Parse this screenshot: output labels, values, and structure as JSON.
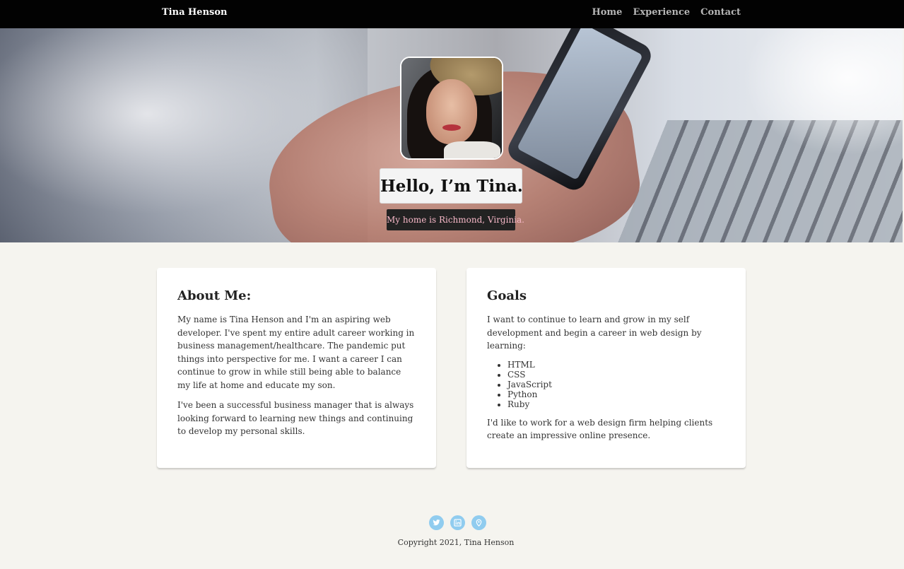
{
  "nav": {
    "brand": "Tina Henson",
    "links": [
      {
        "label": "Home"
      },
      {
        "label": "Experience"
      },
      {
        "label": "Contact"
      }
    ]
  },
  "hero": {
    "title": "Hello, I’m Tina.",
    "subtitle": "My home is Richmond, Virginia.",
    "profile_icon": "profile-photo"
  },
  "about": {
    "heading": "About Me:",
    "paragraphs": [
      "My name is Tina Henson and I'm an aspiring web developer. I've spent my entire adult career working in business management/healthcare. The pandemic put things into perspective for me. I want a career I can continue to grow in while still being able to balance my life at home and educate my son.",
      "I've been a successful business manager that is always looking forward to learning new things and continuing to develop my personal skills."
    ]
  },
  "goals": {
    "heading": "Goals",
    "intro": "I want to continue to learn and grow in my self development and begin a career in web design by learning:",
    "skills": [
      "HTML",
      "CSS",
      "JavaScript",
      "Python",
      "Ruby"
    ],
    "outro": "I'd like to work for a web design firm helping clients create an impressive online presence."
  },
  "footer": {
    "social_icons": [
      "twitter-icon",
      "linkedin-icon",
      "location-icon"
    ],
    "copyright": "Copyright 2021, Tina Henson"
  },
  "colors": {
    "nav_bg": "#020202",
    "page_bg": "#f5f4ef",
    "subtitle_text": "#f7b8c8",
    "social_icon_bg": "#90ccef"
  }
}
